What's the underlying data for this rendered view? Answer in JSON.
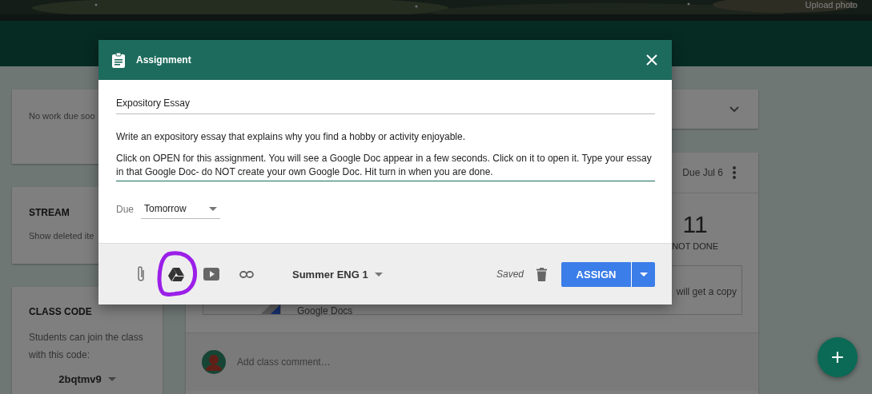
{
  "header": {
    "upload_label": "Upload photo"
  },
  "sidebar": {
    "upcoming": {
      "text": "No work due soo"
    },
    "stream": {
      "title": "STREAM",
      "link": "Show deleted ite"
    },
    "class_code": {
      "title": "CLASS CODE",
      "text": "Students can join the class with this code:",
      "code": "2bqtmv9"
    }
  },
  "stream_card": {
    "due": "Due Jul 6",
    "count": "11",
    "count_label": "NOT DONE",
    "attachment": {
      "title": "Google Docs",
      "note": "will get a copy"
    },
    "comment_placeholder": "Add class comment…"
  },
  "fab": {
    "label": "+"
  },
  "dialog": {
    "title": "Assignment",
    "title_field": {
      "value": "Expository Essay"
    },
    "instructions": {
      "paragraphs": [
        "Write an expository essay that explains why you find a hobby or activity enjoyable.",
        "Click on OPEN for this assignment. You will see a Google Doc appear in a few seconds. Click on it to open it. Type your essay in that Google Doc- do NOT create your own Google Doc. Hit turn in when you are done."
      ]
    },
    "due": {
      "label": "Due",
      "value": "Tomorrow"
    },
    "attachments": [
      {
        "kind": "file",
        "circled": false
      },
      {
        "kind": "drive",
        "circled": true
      },
      {
        "kind": "youtube",
        "circled": false
      },
      {
        "kind": "link",
        "circled": false
      }
    ],
    "class_name": "Summer ENG 1",
    "status": "Saved",
    "assign_label": "ASSIGN"
  }
}
